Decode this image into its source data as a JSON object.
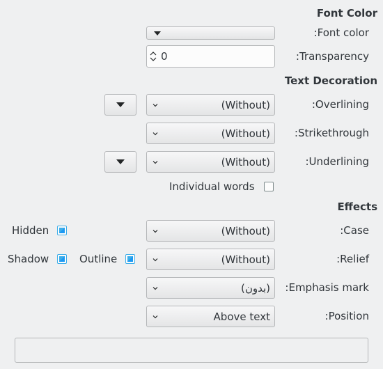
{
  "font_color": {
    "heading": "Font Color",
    "label": ":Font color",
    "transparency_label": ":Transparency",
    "transparency_value": "0"
  },
  "text_decoration": {
    "heading": "Text Decoration",
    "overlining_label": ":Overlining",
    "overlining_value": "(Without)",
    "strikethrough_label": ":Strikethrough",
    "strikethrough_value": "(Without)",
    "underlining_label": ":Underlining",
    "underlining_value": "(Without)",
    "individual_words_label": "Individual words"
  },
  "effects": {
    "heading": "Effects",
    "case_label": ":Case",
    "case_value": "(Without)",
    "relief_label": ":Relief",
    "relief_value": "(Without)",
    "emphasis_label": ":Emphasis mark",
    "emphasis_value": "(بدون)",
    "position_label": ":Position",
    "position_value": "Above text",
    "hidden_label": "Hidden",
    "shadow_label": "Shadow",
    "outline_label": "Outline"
  },
  "colors": {
    "background": "#eff0f1",
    "accent": "#3daee9"
  }
}
